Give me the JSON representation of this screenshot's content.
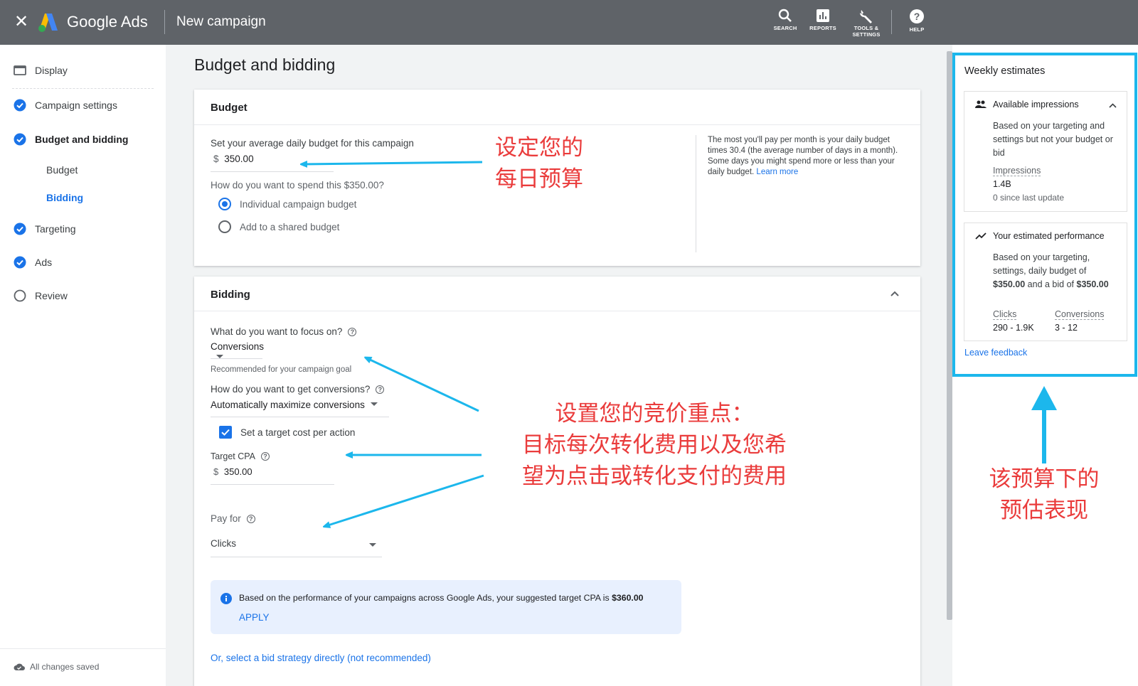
{
  "topbar": {
    "brand": "Google Ads",
    "page_title": "New campaign",
    "tools": [
      {
        "label": "SEARCH",
        "icon": "search-icon"
      },
      {
        "label": "REPORTS",
        "icon": "reports-icon"
      },
      {
        "label": "TOOLS &\nSETTINGS",
        "icon": "wrench-icon"
      },
      {
        "label": "HELP",
        "icon": "help-icon"
      }
    ]
  },
  "sidebar": {
    "items": [
      {
        "label": "Display",
        "icon": "display-icon"
      },
      {
        "label": "Campaign settings",
        "icon": "check-circle-icon"
      },
      {
        "label": "Budget and bidding",
        "icon": "check-circle-icon"
      },
      {
        "label": "Targeting",
        "icon": "check-circle-icon"
      },
      {
        "label": "Ads",
        "icon": "check-circle-icon"
      },
      {
        "label": "Review",
        "icon": "empty-circle-icon"
      }
    ],
    "subitems": [
      "Budget",
      "Bidding"
    ],
    "saved": "All changes saved"
  },
  "main": {
    "title": "Budget and bidding",
    "budget": {
      "header": "Budget",
      "daily_label": "Set your average daily budget for this campaign",
      "currency": "$",
      "daily_value": "350.00",
      "spend_question": "How do you want to spend this $350.00?",
      "options": [
        "Individual campaign budget",
        "Add to a shared budget"
      ],
      "info_text": "The most you'll pay per month is your daily budget times 30.4 (the average number of days in a month). Some days you might spend more or less than your daily budget.",
      "learn_more": "Learn more"
    },
    "bidding": {
      "header": "Bidding",
      "focus_label": "What do you want to focus on?",
      "focus_value": "Conversions",
      "focus_hint": "Recommended for your campaign goal",
      "how_label": "How do you want to get conversions?",
      "how_value": "Automatically maximize conversions",
      "target_checkbox": "Set a target cost per action",
      "cpa_label": "Target CPA",
      "cpa_currency": "$",
      "cpa_value": "350.00",
      "payfor_label": "Pay for",
      "payfor_value": "Clicks",
      "suggest_text": "Based on the performance of your campaigns across Google Ads, your suggested target CPA is",
      "suggest_amount": "$360.00",
      "apply": "APPLY",
      "direct_link": "Or, select a bid strategy directly (not recommended)"
    }
  },
  "estimates": {
    "title": "Weekly estimates",
    "impressions_card": {
      "title": "Available impressions",
      "desc": "Based on your targeting and settings but not your budget or bid",
      "metric_label": "Impressions",
      "metric_value": "1.4B",
      "since": "0 since last update"
    },
    "performance_card": {
      "title": "Your estimated performance",
      "desc_pre": "Based on your targeting, settings, daily budget of",
      "budget": "$350.00",
      "desc_mid": "and a bid of",
      "bid": "$350.00",
      "clicks_label": "Clicks",
      "clicks_value": "290 - 1.9K",
      "conv_label": "Conversions",
      "conv_value": "3 - 12"
    },
    "feedback": "Leave feedback"
  },
  "annotations": {
    "budget_note_1": "设定您的",
    "budget_note_2": "每日预算",
    "bid_note_1": "设置您的竞价重点：",
    "bid_note_2": "目标每次转化费用以及您希",
    "bid_note_3": "望为点击或转化支付的费用",
    "est_note_1": "该预算下的",
    "est_note_2": "预估表现"
  },
  "colors": {
    "accent": "#1a73e8",
    "topbar": "#5f6368",
    "highlight": "#1cb7ec",
    "annotation": "#ea3c3c"
  }
}
